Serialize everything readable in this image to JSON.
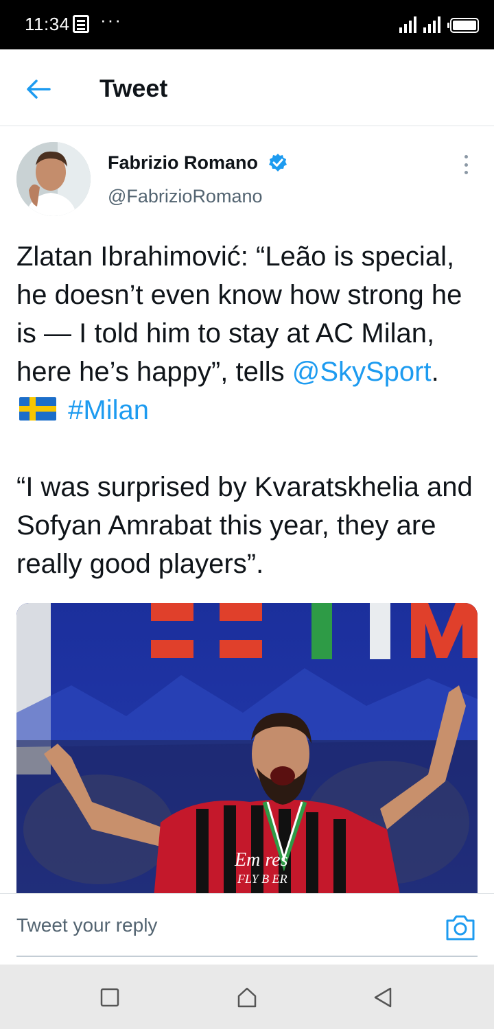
{
  "status_bar": {
    "time": "11:34",
    "more_glyph": "···",
    "icons": [
      "notification-icon",
      "signal-icon",
      "signal-icon",
      "battery-icon"
    ]
  },
  "header": {
    "back_icon": "arrow-left-icon",
    "title": "Tweet"
  },
  "tweet": {
    "author": {
      "name": "Fabrizio Romano",
      "handle": "@FabrizioRomano",
      "verified": true,
      "avatar_icon": "avatar"
    },
    "text": {
      "para1_start": "Zlatan Ibrahimović: “Leão is special, he doesn’t even know how strong he is — I told him to stay at AC Milan, here he’s happy”, tells ",
      "mention": "@SkySport",
      "after_mention": ". ",
      "flag_emoji": "sweden-flag",
      "hashtag": "#Milan",
      "para2": "“I was surprised by Kvaratskhelia and Sofyan Amrabat this year, they are really good players”."
    },
    "media": {
      "jersey_text_top": "Em   res",
      "jersey_text_bottom": "FLY B  ER"
    }
  },
  "reply": {
    "placeholder": "Tweet your reply",
    "camera_icon": "camera-icon"
  },
  "nav_bar": {
    "items": [
      "recents-square-icon",
      "home-icon",
      "back-triangle-icon"
    ]
  },
  "colors": {
    "link": "#1d9bf0",
    "text": "#0f1419",
    "secondary": "#536471",
    "status_bar": "#000000"
  }
}
